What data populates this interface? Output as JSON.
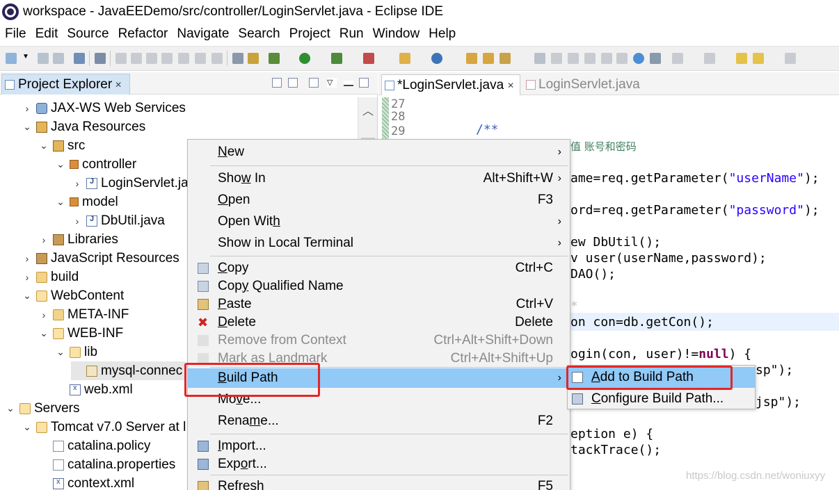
{
  "window": {
    "title": "workspace - JavaEEDemo/src/controller/LoginServlet.java - Eclipse IDE"
  },
  "menubar": [
    "File",
    "Edit",
    "Source",
    "Refactor",
    "Navigate",
    "Search",
    "Project",
    "Run",
    "Window",
    "Help"
  ],
  "explorer": {
    "tab_label": "Project Explorer",
    "tree": [
      {
        "label": "JAX-WS Web Services",
        "arrow": "›",
        "icon": "webservice-icon"
      },
      {
        "label": "Java Resources",
        "arrow": "⌄",
        "icon": "java-resources-icon"
      },
      {
        "label": "src",
        "arrow": "⌄",
        "icon": "source-folder-icon"
      },
      {
        "label": "controller",
        "arrow": "⌄",
        "icon": "package-icon"
      },
      {
        "label": "LoginServlet.ja",
        "arrow": "›",
        "icon": "java-file-icon"
      },
      {
        "label": "model",
        "arrow": "⌄",
        "icon": "package-icon"
      },
      {
        "label": "DbUtil.java",
        "arrow": "›",
        "icon": "java-file-icon"
      },
      {
        "label": "Libraries",
        "arrow": "›",
        "icon": "library-icon"
      },
      {
        "label": "JavaScript Resources",
        "arrow": "›",
        "icon": "library-icon"
      },
      {
        "label": "build",
        "arrow": "›",
        "icon": "folder-icon"
      },
      {
        "label": "WebContent",
        "arrow": "⌄",
        "icon": "folder-open-icon"
      },
      {
        "label": "META-INF",
        "arrow": "›",
        "icon": "folder-icon"
      },
      {
        "label": "WEB-INF",
        "arrow": "⌄",
        "icon": "folder-open-icon"
      },
      {
        "label": "lib",
        "arrow": "⌄",
        "icon": "folder-open-icon"
      },
      {
        "label": "mysql-connec",
        "arrow": "",
        "icon": "jar-file-icon"
      },
      {
        "label": "web.xml",
        "arrow": "",
        "icon": "xml-file-icon"
      },
      {
        "label": "Servers",
        "arrow": "⌄",
        "icon": "folder-open-icon"
      },
      {
        "label": "Tomcat v7.0 Server at l",
        "arrow": "⌄",
        "icon": "folder-open-icon"
      },
      {
        "label": "catalina.policy",
        "arrow": "",
        "icon": "file-icon"
      },
      {
        "label": "catalina.properties",
        "arrow": "",
        "icon": "file-icon"
      },
      {
        "label": "context.xml",
        "arrow": "",
        "icon": "xml-file-icon"
      }
    ]
  },
  "editor": {
    "tabs": [
      {
        "label": "*LoginServlet.java",
        "active": true
      },
      {
        "label": "LoginServlet.java",
        "active": false
      }
    ],
    "line_numbers": [
      "27",
      "28",
      "29"
    ],
    "code": {
      "doc_start": "/**",
      "comment_cn": "值 账号和密码",
      "line_username_a": "ame=req.getParameter(",
      "line_username_s": "\"userName\"",
      "line_username_b": ");",
      "line_password_a": "ord=req.getParameter(",
      "line_password_s": "\"password\"",
      "line_password_b": ");",
      "line_dbutil": "ew DbUtil();",
      "line_user": "v user(userName,password);",
      "line_dao": "DAO();",
      "line_star": "*",
      "line_con": "on con=db.getCon();",
      "line_login_a": "ogin(con, user)!=",
      "line_login_kw": "null",
      "line_login_b": ") {",
      "line_jsp1": "sp\");",
      "line_jsp2": "jsp\");",
      "line_exc": "eption e) {",
      "line_trace": "tackTrace();"
    },
    "watermark": "https://blog.csdn.net/woniuxyy"
  },
  "context_menu": {
    "items": [
      {
        "label": "New",
        "u": "N",
        "shortcut": "",
        "submenu": true,
        "icon": "",
        "disabled": false
      },
      {
        "label": "Show In",
        "u": "w",
        "shortcut": "Alt+Shift+W",
        "submenu": true,
        "icon": "",
        "disabled": false
      },
      {
        "label": "Open",
        "u": "O",
        "shortcut": "F3",
        "submenu": false,
        "icon": "",
        "disabled": false
      },
      {
        "label": "Open With",
        "u": "h",
        "shortcut": "",
        "submenu": true,
        "icon": "",
        "disabled": false
      },
      {
        "label": "Show in Local Terminal",
        "u": "",
        "shortcut": "",
        "submenu": true,
        "icon": "",
        "disabled": false
      },
      {
        "label": "Copy",
        "u": "C",
        "shortcut": "Ctrl+C",
        "submenu": false,
        "icon": "copy-icon",
        "disabled": false
      },
      {
        "label": "Copy Qualified Name",
        "u": "y",
        "shortcut": "",
        "submenu": false,
        "icon": "copy-qualified-icon",
        "disabled": false
      },
      {
        "label": "Paste",
        "u": "P",
        "shortcut": "Ctrl+V",
        "submenu": false,
        "icon": "paste-icon",
        "disabled": false
      },
      {
        "label": "Delete",
        "u": "D",
        "shortcut": "Delete",
        "submenu": false,
        "icon": "delete-icon",
        "disabled": false
      },
      {
        "label": "Remove from Context",
        "u": "",
        "shortcut": "Ctrl+Alt+Shift+Down",
        "submenu": false,
        "icon": "remove-context-icon",
        "disabled": true
      },
      {
        "label": "Mark as Landmark",
        "u": "",
        "shortcut": "Ctrl+Alt+Shift+Up",
        "submenu": false,
        "icon": "landmark-icon",
        "disabled": true
      },
      {
        "label": "Build Path",
        "u": "B",
        "shortcut": "",
        "submenu": true,
        "icon": "",
        "disabled": false,
        "selected": true
      },
      {
        "label": "Move...",
        "u": "v",
        "shortcut": "",
        "submenu": false,
        "icon": "",
        "disabled": false
      },
      {
        "label": "Rename...",
        "u": "m",
        "shortcut": "F2",
        "submenu": false,
        "icon": "",
        "disabled": false
      },
      {
        "label": "Import...",
        "u": "I",
        "shortcut": "",
        "submenu": false,
        "icon": "import-icon",
        "disabled": false
      },
      {
        "label": "Export...",
        "u": "o",
        "shortcut": "",
        "submenu": false,
        "icon": "export-icon",
        "disabled": false
      },
      {
        "label": "Refresh",
        "u": "f",
        "shortcut": "F5",
        "submenu": false,
        "icon": "refresh-icon",
        "disabled": false
      }
    ]
  },
  "build_path_submenu": {
    "items": [
      {
        "label": "Add to Build Path",
        "u": "A",
        "icon": "add-build-path-icon",
        "selected": true
      },
      {
        "label": "Configure Build Path...",
        "u": "C",
        "icon": "configure-build-path-icon",
        "selected": false
      }
    ]
  },
  "colors": {
    "selection": "#91c9f7",
    "highlight_box": "#e32626",
    "tab_active": "#d3e4f5"
  }
}
